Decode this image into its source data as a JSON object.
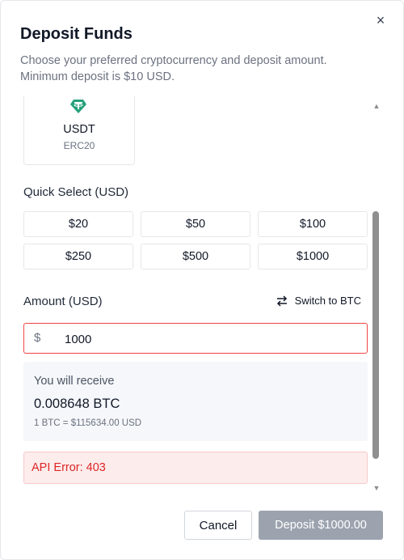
{
  "dialog": {
    "title": "Deposit Funds",
    "subtitle": "Choose your preferred cryptocurrency and deposit amount. Minimum deposit is $10 USD.",
    "close_icon": "×"
  },
  "crypto": {
    "name": "USDT",
    "network": "ERC20",
    "icon": "tether-icon",
    "icon_color": "#26a17b"
  },
  "quick_select": {
    "label": "Quick Select (USD)",
    "options": [
      "$20",
      "$50",
      "$100",
      "$250",
      "$500",
      "$1000"
    ]
  },
  "amount": {
    "label": "Amount (USD)",
    "switch_label": "Switch to BTC",
    "prefix": "$",
    "value": "1000"
  },
  "receive": {
    "label": "You will receive",
    "value": "0.008648 BTC",
    "rate": "1 BTC = $115634.00 USD"
  },
  "error": {
    "message": "API Error: 403"
  },
  "footer": {
    "cancel_label": "Cancel",
    "deposit_label": "Deposit $1000.00"
  },
  "colors": {
    "error": "#dc2626",
    "error_bg": "#fdecec",
    "disabled_button": "#9ca3af"
  }
}
